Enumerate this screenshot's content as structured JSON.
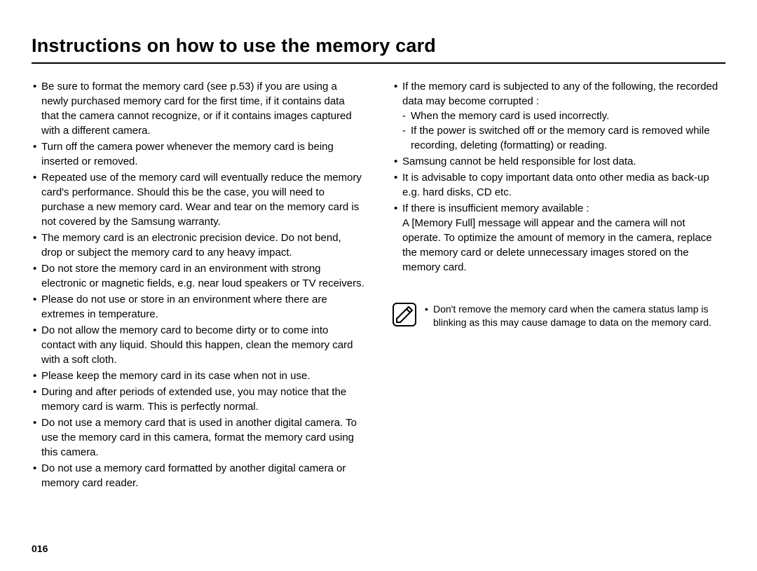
{
  "title": "Instructions on how to use the memory card",
  "page_number": "016",
  "left_column": [
    {
      "text": "Be sure to format the memory card (see p.53) if you are using a newly purchased memory card for the first time, if it contains data that the camera cannot recognize, or if it contains images captured with a different camera."
    },
    {
      "text": "Turn off the camera power whenever the memory card is being inserted or removed."
    },
    {
      "text": "Repeated use of the memory card will eventually reduce the memory card's performance. Should this be the case, you will need to purchase a new memory card. Wear and tear on the memory card is not covered by the Samsung warranty."
    },
    {
      "text": "The memory card is an electronic precision device. Do not bend, drop or subject the memory card to any heavy impact."
    },
    {
      "text": "Do not store the memory card in an environment with strong electronic or magnetic fields, e.g. near loud speakers or TV receivers."
    },
    {
      "text": "Please do not use or store in an environment where there are extremes in temperature."
    },
    {
      "text": "Do not allow the memory card to become dirty or to come into contact with any liquid. Should this happen, clean the memory card with a soft cloth."
    },
    {
      "text": "Please keep the memory card in its case when not in use."
    },
    {
      "text": "During and after periods of extended use, you may notice that the memory card is warm. This is perfectly normal."
    },
    {
      "text": "Do not use a memory card that is used in another digital camera. To use the memory card in this camera, format the memory card using this camera."
    },
    {
      "text": "Do not use a memory card formatted by another digital camera or memory card reader."
    }
  ],
  "right_column": [
    {
      "text": "If the memory card is subjected to any of the following, the recorded data may become corrupted :",
      "sub": [
        "When the memory card is used incorrectly.",
        "If the power is switched off or the memory card is removed while recording, deleting (formatting) or reading."
      ]
    },
    {
      "text": "Samsung cannot be held responsible for lost data."
    },
    {
      "text": "It is advisable to copy important data onto other media as back-up e.g. hard disks, CD etc."
    },
    {
      "text": "If there is insufficient memory available :",
      "continuation": "A [Memory Full] message will appear and the camera will not operate. To optimize the amount of memory in the camera, replace the memory card or delete unnecessary images stored on the memory card."
    }
  ],
  "note": "Don't remove the memory card when the camera status lamp is blinking as this may cause damage to data on the memory card."
}
